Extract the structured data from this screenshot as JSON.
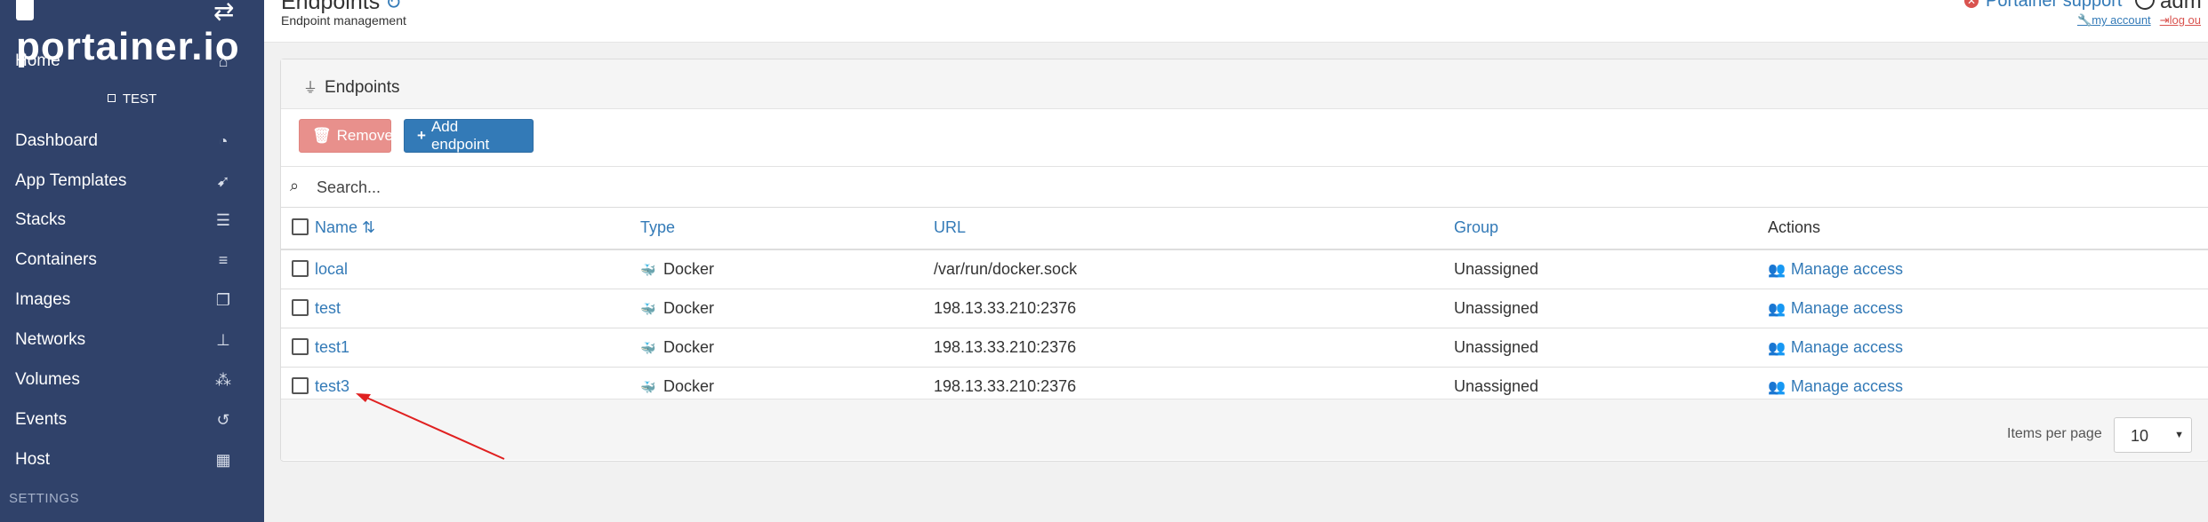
{
  "sidebar": {
    "logo": "portainer.io",
    "swap_icon": "exchange-icon",
    "environment": "TEST",
    "settings_label": "SETTINGS",
    "items": [
      {
        "label": "Home",
        "icon": "home-icon"
      },
      {
        "label": "Dashboard",
        "icon": "tachometer-icon"
      },
      {
        "label": "App Templates",
        "icon": "rocket-icon"
      },
      {
        "label": "Stacks",
        "icon": "th-list-icon"
      },
      {
        "label": "Containers",
        "icon": "server-icon"
      },
      {
        "label": "Images",
        "icon": "clone-icon"
      },
      {
        "label": "Networks",
        "icon": "sitemap-icon"
      },
      {
        "label": "Volumes",
        "icon": "cubes-icon"
      },
      {
        "label": "Events",
        "icon": "history-icon"
      },
      {
        "label": "Host",
        "icon": "th-icon"
      }
    ]
  },
  "header": {
    "title": "Endpoints",
    "breadcrumb": "Endpoint management",
    "support": "Portainer support",
    "user": "adm",
    "my_account": "my account",
    "logout": "log ou"
  },
  "widget": {
    "title": "Endpoints",
    "remove_label": "Remove",
    "add_label": "Add endpoint",
    "search_placeholder": "Search...",
    "columns": {
      "name": "Name",
      "type": "Type",
      "url": "URL",
      "group": "Group",
      "actions": "Actions"
    },
    "rows": [
      {
        "name": "local",
        "type": "Docker",
        "url": "/var/run/docker.sock",
        "group": "Unassigned",
        "action": "Manage access"
      },
      {
        "name": "test",
        "type": "Docker",
        "url": "198.13.33.210:2376",
        "group": "Unassigned",
        "action": "Manage access"
      },
      {
        "name": "test1",
        "type": "Docker",
        "url": "198.13.33.210:2376",
        "group": "Unassigned",
        "action": "Manage access"
      },
      {
        "name": "test3",
        "type": "Docker",
        "url": "198.13.33.210:2376",
        "group": "Unassigned",
        "action": "Manage access"
      }
    ],
    "items_per_page_label": "Items per page",
    "items_per_page_value": "10"
  },
  "colors": {
    "sidebar": "#30426a",
    "accent": "#337ab7",
    "danger": "#e8908c",
    "annotation": "#e02020"
  }
}
